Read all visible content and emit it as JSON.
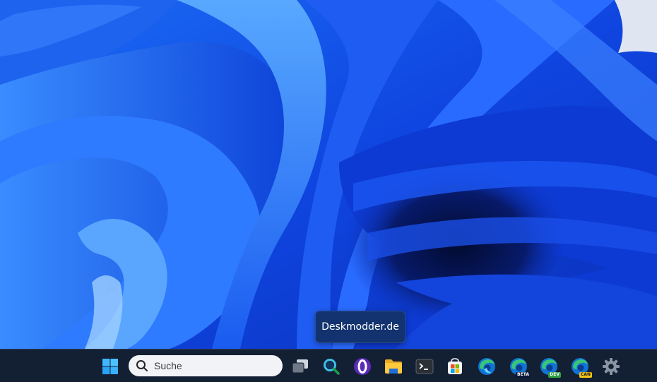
{
  "desktop": {
    "tooltip": "Deskmodder.de"
  },
  "taskbar": {
    "search_placeholder": "Suche",
    "icons": {
      "start": "windows-logo",
      "task_view": "task-view-icon",
      "search_app": "search-magnifier-icon",
      "opera": "opera-icon",
      "explorer": "folder-icon",
      "terminal": "terminal-icon",
      "store": "store-icon",
      "edge": "edge-icon",
      "edge_beta": "edge-beta-icon",
      "edge_dev": "edge-dev-icon",
      "edge_canary": "edge-canary-icon",
      "settings": "gear-icon"
    },
    "badges": {
      "beta": "BETA",
      "dev": "DEV",
      "canary": "CAN"
    }
  },
  "colors": {
    "taskbar_bg": "#131f33",
    "wallpaper_primary": "#1452f0",
    "accent": "#4cc2ff"
  }
}
